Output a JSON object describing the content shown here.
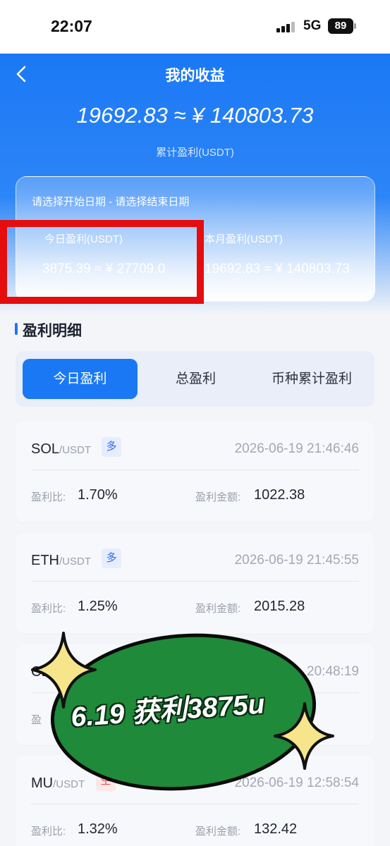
{
  "status": {
    "time": "22:07",
    "network": "5G",
    "battery": "89"
  },
  "header": {
    "title": "我的收益",
    "total_amount": "19692.83 ≈ ¥ 140803.73",
    "total_label": "累计盈利(USDT)"
  },
  "summary": {
    "date_range": "请选择开始日期 - 请选择结束日期",
    "today_label": "今日盈利(USDT)",
    "today_value": "3875.39 ≈ ¥ 27709.0",
    "month_label": "本月盈利(USDT)",
    "month_value": "19692.83 ≈ ¥ 140803.73"
  },
  "section": {
    "title": "盈利明细"
  },
  "tabs": [
    {
      "label": "今日盈利",
      "active": true
    },
    {
      "label": "总盈利",
      "active": false
    },
    {
      "label": "币种累计盈利",
      "active": false
    }
  ],
  "records": [
    {
      "base": "SOL",
      "quote": "/USDT",
      "side": "多",
      "time": "2026-06-19 21:46:46",
      "rate_label": "盈利比:",
      "rate": "1.70%",
      "amount_label": "盈利金额:",
      "amount": "1022.38"
    },
    {
      "base": "ETH",
      "quote": "/USDT",
      "side": "多",
      "time": "2026-06-19 21:45:55",
      "rate_label": "盈利比:",
      "rate": "1.25%",
      "amount_label": "盈利金额:",
      "amount": "2015.28"
    },
    {
      "base": "CL",
      "quote": "/",
      "side": "",
      "time": "20:48:19",
      "rate_label": "盈",
      "rate": "",
      "amount_label": "",
      "amount": ""
    },
    {
      "base": "MU",
      "quote": "/USDT",
      "side": "空",
      "time": "2026-06-19 12:58:54",
      "rate_label": "盈利比:",
      "rate": "1.32%",
      "amount_label": "盈利金额:",
      "amount": "132.42"
    }
  ],
  "sticker": {
    "text": "6.19 获利3875u",
    "color": "#1f8a3a"
  }
}
